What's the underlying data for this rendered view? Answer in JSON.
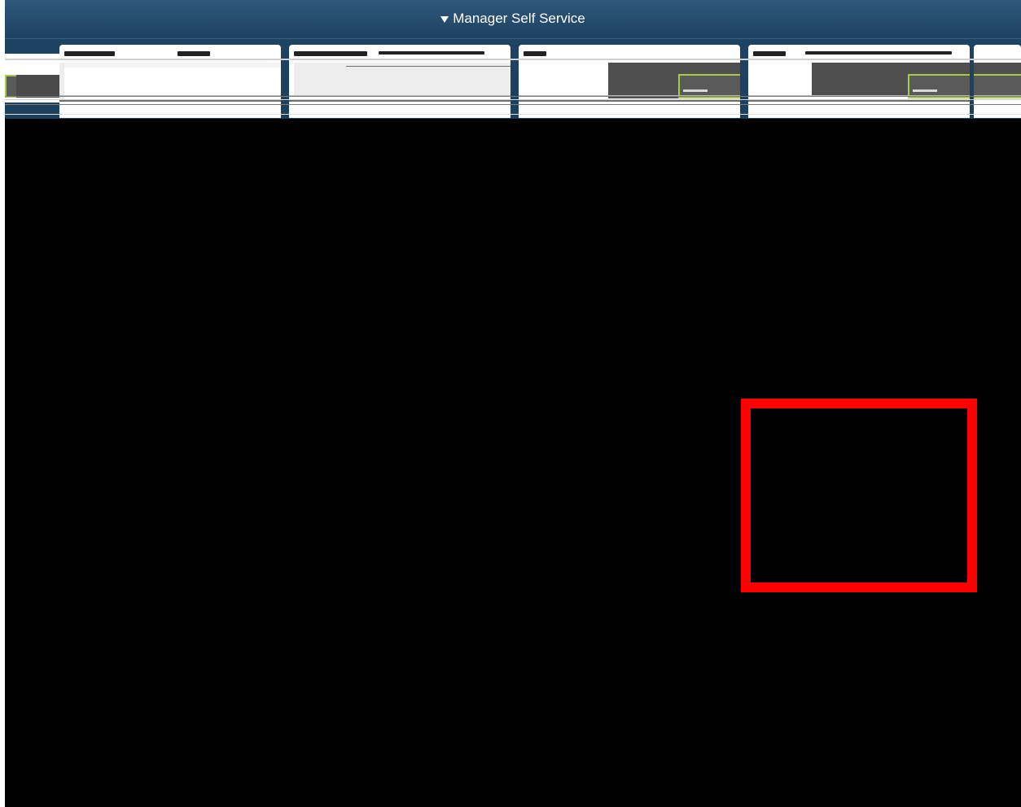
{
  "header": {
    "title": "Manager Self Service",
    "caret_icon": "caret-down-icon",
    "background": "#1e4262"
  },
  "tiles": [
    {
      "name": "tile-1"
    },
    {
      "name": "tile-2"
    },
    {
      "name": "tile-3"
    },
    {
      "name": "tile-4"
    }
  ],
  "highlight": {
    "color": "#ff0000"
  },
  "colors": {
    "main_background": "#000000",
    "tile_frame_accent": "#a8cc4a"
  }
}
